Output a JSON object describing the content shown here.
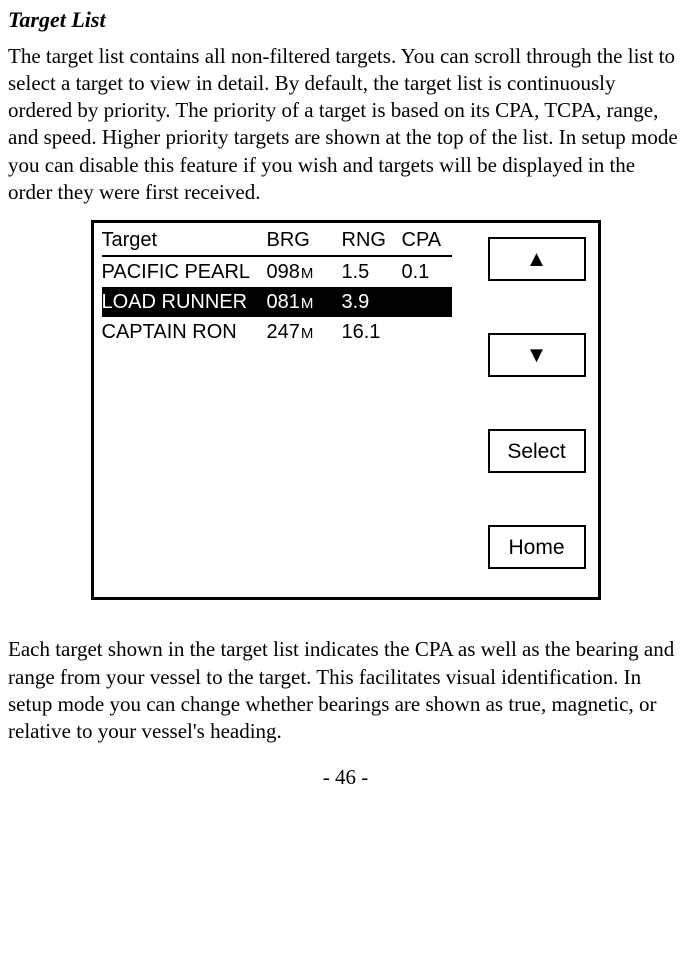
{
  "section_title": "Target List",
  "paragraph_1": "The target list contains all non-filtered targets. You can scroll through the list to select a target to view in detail. By default, the target list is continuously ordered by priority. The priority of a target is based on its CPA, TCPA, range, and speed. Higher priority targets are shown at the top of the list. In setup mode you can disable this feature if you wish and targets will be displayed in the order they were first received.",
  "paragraph_2": "Each target shown in the target list indicates the CPA as well as the bearing and range from your vessel to the target. This facilitates visual identification. In setup mode you can change whether bearings are shown as true, magnetic, or relative to your vessel's heading.",
  "page_number": "- 46 -",
  "panel": {
    "headers": {
      "target": "Target",
      "brg": "BRG",
      "rng": "RNG",
      "cpa": "CPA"
    },
    "rows": [
      {
        "name": "PACIFIC PEARL",
        "brg": "098",
        "brg_unit": "M",
        "rng": "1.5",
        "cpa": "0.1"
      },
      {
        "name": "LOAD RUNNER",
        "brg": "081",
        "brg_unit": "M",
        "rng": "3.9",
        "cpa": ""
      },
      {
        "name": "CAPTAIN RON",
        "brg": "247",
        "brg_unit": "M",
        "rng": "16.1",
        "cpa": ""
      }
    ],
    "selected_index": 1,
    "buttons": {
      "up": "▲",
      "down": "▼",
      "select": "Select",
      "home": "Home"
    }
  }
}
